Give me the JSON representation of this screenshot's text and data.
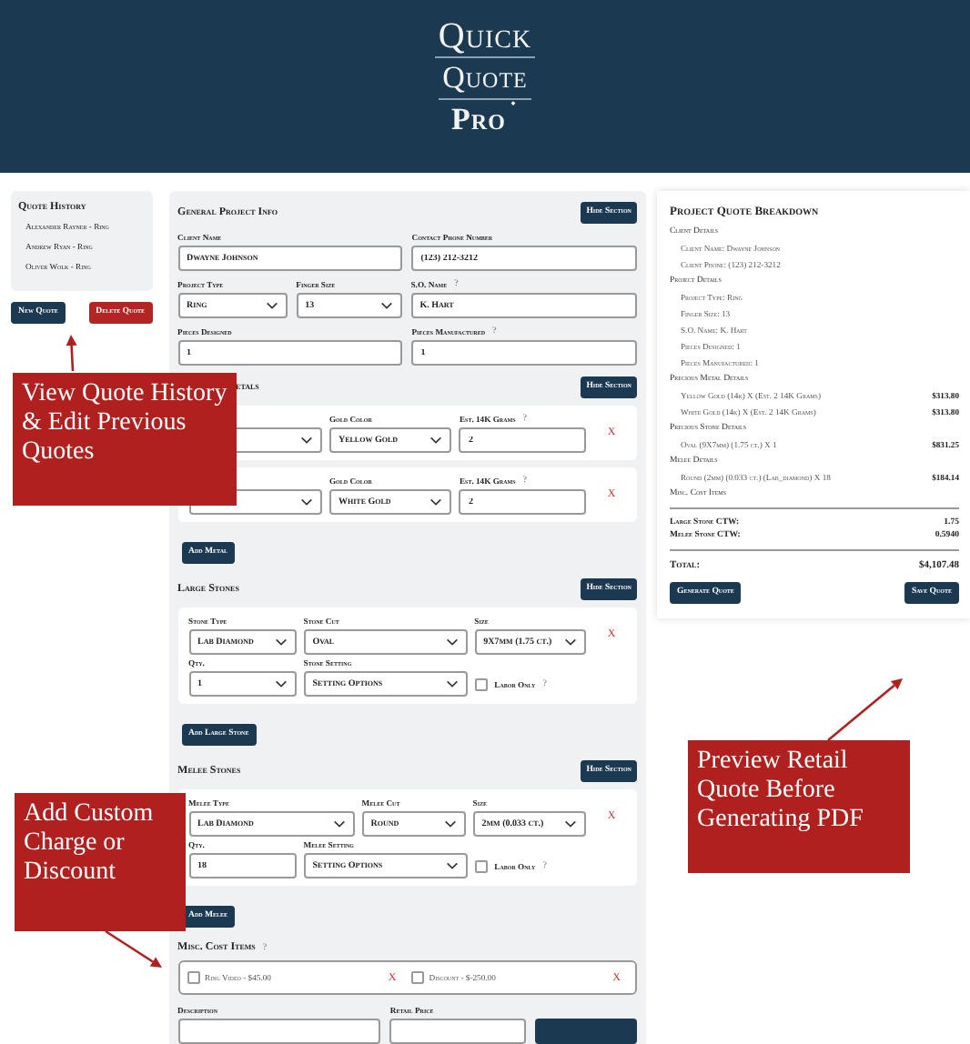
{
  "header": {
    "logo_lines": [
      "Quick",
      "Quote",
      "Pro"
    ]
  },
  "quote_history": {
    "title": "Quote History",
    "items": [
      {
        "label": "Alexander Rayner - Ring",
        "selected": false
      },
      {
        "label": "Andrew Ryan - Ring",
        "selected": false
      },
      {
        "label": "Oliver Wolk - Ring",
        "selected": false
      }
    ]
  },
  "history_buttons": [
    {
      "label": "New Quote",
      "kind": "primary"
    },
    {
      "label": "Delete Quote",
      "kind": "danger"
    }
  ],
  "form": {
    "sections": [
      {
        "kind": "general",
        "title": "General Project Info",
        "action": "Hide Section",
        "rows": [
          [
            {
              "kind": "input",
              "label": "Client Name",
              "value": "Dwayne Johnson"
            },
            {
              "kind": "input",
              "label": "Contact Phone Number",
              "value": "(123) 212-3212"
            }
          ],
          [
            {
              "kind": "select",
              "label": "Project Type",
              "value": "Ring"
            },
            {
              "kind": "select",
              "label": "Finger Size",
              "value": "13"
            },
            {
              "kind": "input",
              "label": "S.O. Name",
              "help": "?",
              "value": "K. Hart"
            }
          ],
          [
            {
              "kind": "input",
              "label": "Pieces Designed",
              "value": "1"
            },
            {
              "kind": "input",
              "label": "Pieces Manufactured",
              "help": "?",
              "value": "1"
            }
          ]
        ]
      },
      {
        "kind": "metal",
        "title": "etals",
        "action": "Hide Section",
        "cards": [
          {
            "remove": "X",
            "rows": [
              [
                {
                  "kind": "select"
                },
                {
                  "kind": "select",
                  "label": "Gold Color",
                  "value": "Yellow Gold"
                },
                {
                  "kind": "input",
                  "label": "Est. 14K Grams",
                  "help": "?",
                  "value": "2"
                }
              ]
            ]
          },
          {
            "remove": "X",
            "rows": [
              [
                {
                  "kind": "select"
                },
                {
                  "kind": "select",
                  "label": "Gold Color",
                  "value": "White Gold"
                },
                {
                  "kind": "input",
                  "label": "Est. 14K Grams",
                  "help": "?",
                  "value": "2"
                }
              ]
            ]
          }
        ],
        "add_button": "Add Metal"
      },
      {
        "kind": "large_stone",
        "title": "Large Stones",
        "action": "Hide Section",
        "cards": [
          {
            "remove": "X",
            "rows": [
              [
                {
                  "kind": "select",
                  "label": "Stone Type",
                  "value": "Lab Diamond"
                },
                {
                  "kind": "select",
                  "label": "Stone Cut",
                  "value": "Oval"
                },
                {
                  "kind": "select",
                  "label": "Size",
                  "value": "9X7mm (1.75 ct.)"
                }
              ],
              [
                {
                  "kind": "select",
                  "label": "Qty.",
                  "value": "1"
                },
                {
                  "kind": "select",
                  "label": "Stone Setting",
                  "value": "Setting Options"
                },
                {
                  "kind": "checkbox",
                  "label": "Labor Only",
                  "help": "?",
                  "checked": false
                }
              ]
            ]
          }
        ],
        "add_button": "Add Large Stone"
      },
      {
        "kind": "melee",
        "title": "Melee Stones",
        "action": "Hide Section",
        "cards": [
          {
            "remove": "X",
            "rows": [
              [
                {
                  "kind": "select",
                  "label": "Melee Type",
                  "value": "Lab Diamond"
                },
                {
                  "kind": "select",
                  "label": "Melee Cut",
                  "value": "Round"
                },
                {
                  "kind": "select",
                  "label": "Size",
                  "value": "2mm (0.033 ct.)"
                }
              ],
              [
                {
                  "kind": "input",
                  "label": "Qty.",
                  "value": "18"
                },
                {
                  "kind": "select",
                  "label": "Melee Setting",
                  "value": "Setting Options"
                },
                {
                  "kind": "checkbox",
                  "label": "Labor Only",
                  "help": "?",
                  "checked": false
                }
              ]
            ]
          }
        ],
        "add_button": "Add Melee"
      },
      {
        "kind": "misc",
        "title": "Misc. Cost Items",
        "help": "?",
        "items": [
          {
            "label": "Ring Video - $45.00",
            "checked": false,
            "remove": "X"
          },
          {
            "label": "Discount - $-250.00",
            "checked": false,
            "remove": "X"
          }
        ],
        "fields": [
          {
            "kind": "input",
            "label": "Description"
          },
          {
            "kind": "input",
            "label": "Retail Price"
          }
        ]
      }
    ]
  },
  "breakdown": {
    "title": "Project Quote Breakdown",
    "groups": [
      {
        "heading": "Client Details",
        "lines": [
          {
            "text": "Client Name: Dwayne Johnson"
          },
          {
            "text": "Client Phone: (123) 212-3212"
          }
        ]
      },
      {
        "heading": "Project Details",
        "lines": [
          {
            "text": "Project Type: Ring"
          },
          {
            "text": "Finger Size: 13"
          },
          {
            "text": "S.O. Name: K. Hart"
          },
          {
            "text": "Pieces Designed: 1"
          },
          {
            "text": "Pieces Manufactured: 1"
          }
        ]
      },
      {
        "heading": "Precious Metal Details",
        "lines": [
          {
            "text": "Yellow Gold (14k) X (Est. 2 14K Grams)",
            "amount": "$313.80"
          },
          {
            "text": "White Gold (14k) X (Est. 2 14K Grams)",
            "amount": "$313.80"
          }
        ]
      },
      {
        "heading": "Precious Stone Details",
        "lines": [
          {
            "text": "Oval (9X7mm) (1.75 ct.) X 1",
            "amount": "$831.25"
          }
        ]
      },
      {
        "heading": "Melee Details",
        "lines": [
          {
            "text": "Round (2mm) (0.033 ct.) (Lab_diamond) X 18",
            "amount": "$184.14"
          }
        ]
      },
      {
        "heading": "Misc. Cost Items"
      }
    ],
    "ctw": [
      {
        "label": "Large Stone CTW:",
        "value": "1.75"
      },
      {
        "label": "Melee Stone CTW:",
        "value": "0.5940"
      }
    ],
    "total": {
      "label": "Total:",
      "value": "$4,107.48"
    },
    "buttons": [
      "Generate Quote",
      "Save Quote"
    ]
  },
  "callouts": [
    {
      "text": "View Quote History & Edit Previous Quotes"
    },
    {
      "text": "Add Custom Charge or Discount"
    },
    {
      "text": "Preview Retail Quote Before Generating PDF"
    }
  ]
}
